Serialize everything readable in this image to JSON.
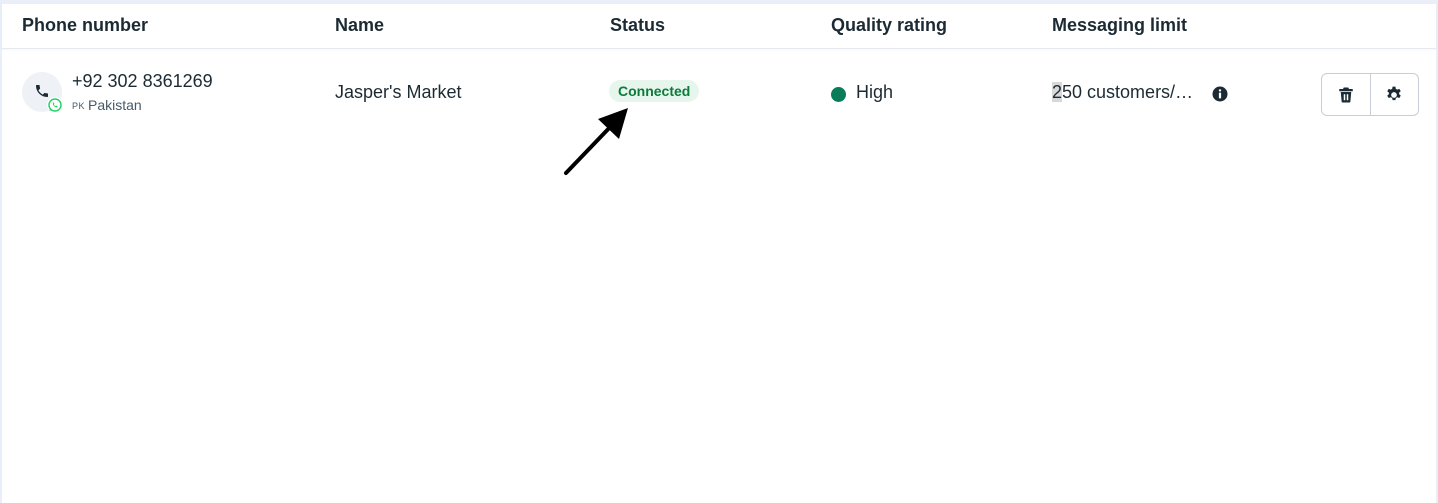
{
  "table": {
    "columns": {
      "phone": "Phone number",
      "name": "Name",
      "status": "Status",
      "quality": "Quality rating",
      "limit": "Messaging limit"
    },
    "rows": [
      {
        "phone_number": "+92 302 8361269",
        "country_code": "PK",
        "country": "Pakistan",
        "name": "Jasper's Market",
        "status": "Connected",
        "quality": "High",
        "limit_first_char": "2",
        "limit_rest": "50 customers/…"
      }
    ]
  },
  "colors": {
    "status_bg": "#e7f6ec",
    "status_text": "#0b7a3b",
    "quality_high": "#0a7c59",
    "whatsapp_green": "#25d366"
  },
  "icons": {
    "phone": "phone-icon",
    "whatsapp": "whatsapp-icon",
    "info": "info-icon",
    "delete": "trash-icon",
    "settings": "gear-icon",
    "annotation": "arrow-icon"
  }
}
